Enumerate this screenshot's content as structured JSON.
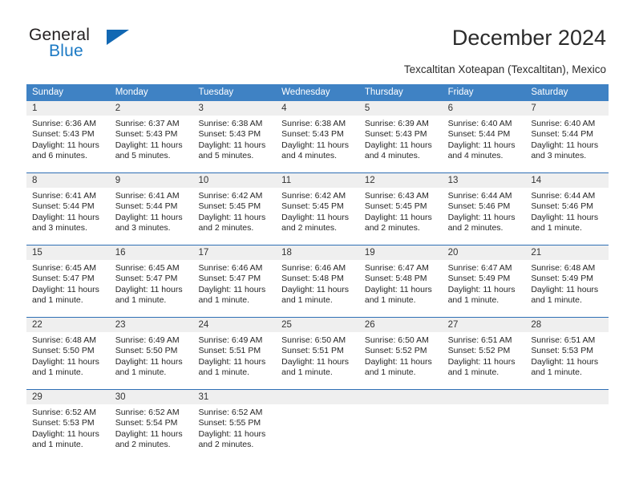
{
  "brand": {
    "word1": "General",
    "word2": "Blue",
    "triangle_icon": "brand-triangle-icon",
    "accent_color": "#1268b3"
  },
  "header": {
    "title": "December 2024",
    "subtitle": "Texcaltitan Xoteapan (Texcaltitan), Mexico"
  },
  "colors": {
    "header_blue": "#3f82c4",
    "row_divider_blue": "#2f6fb5",
    "day_band_gray": "#efefef",
    "text": "#262626"
  },
  "calendar": {
    "weekdays": [
      "Sunday",
      "Monday",
      "Tuesday",
      "Wednesday",
      "Thursday",
      "Friday",
      "Saturday"
    ],
    "weeks": [
      [
        {
          "day": "1",
          "sunrise": "Sunrise: 6:36 AM",
          "sunset": "Sunset: 5:43 PM",
          "daylight": "Daylight: 11 hours and 6 minutes."
        },
        {
          "day": "2",
          "sunrise": "Sunrise: 6:37 AM",
          "sunset": "Sunset: 5:43 PM",
          "daylight": "Daylight: 11 hours and 5 minutes."
        },
        {
          "day": "3",
          "sunrise": "Sunrise: 6:38 AM",
          "sunset": "Sunset: 5:43 PM",
          "daylight": "Daylight: 11 hours and 5 minutes."
        },
        {
          "day": "4",
          "sunrise": "Sunrise: 6:38 AM",
          "sunset": "Sunset: 5:43 PM",
          "daylight": "Daylight: 11 hours and 4 minutes."
        },
        {
          "day": "5",
          "sunrise": "Sunrise: 6:39 AM",
          "sunset": "Sunset: 5:43 PM",
          "daylight": "Daylight: 11 hours and 4 minutes."
        },
        {
          "day": "6",
          "sunrise": "Sunrise: 6:40 AM",
          "sunset": "Sunset: 5:44 PM",
          "daylight": "Daylight: 11 hours and 4 minutes."
        },
        {
          "day": "7",
          "sunrise": "Sunrise: 6:40 AM",
          "sunset": "Sunset: 5:44 PM",
          "daylight": "Daylight: 11 hours and 3 minutes."
        }
      ],
      [
        {
          "day": "8",
          "sunrise": "Sunrise: 6:41 AM",
          "sunset": "Sunset: 5:44 PM",
          "daylight": "Daylight: 11 hours and 3 minutes."
        },
        {
          "day": "9",
          "sunrise": "Sunrise: 6:41 AM",
          "sunset": "Sunset: 5:44 PM",
          "daylight": "Daylight: 11 hours and 3 minutes."
        },
        {
          "day": "10",
          "sunrise": "Sunrise: 6:42 AM",
          "sunset": "Sunset: 5:45 PM",
          "daylight": "Daylight: 11 hours and 2 minutes."
        },
        {
          "day": "11",
          "sunrise": "Sunrise: 6:42 AM",
          "sunset": "Sunset: 5:45 PM",
          "daylight": "Daylight: 11 hours and 2 minutes."
        },
        {
          "day": "12",
          "sunrise": "Sunrise: 6:43 AM",
          "sunset": "Sunset: 5:45 PM",
          "daylight": "Daylight: 11 hours and 2 minutes."
        },
        {
          "day": "13",
          "sunrise": "Sunrise: 6:44 AM",
          "sunset": "Sunset: 5:46 PM",
          "daylight": "Daylight: 11 hours and 2 minutes."
        },
        {
          "day": "14",
          "sunrise": "Sunrise: 6:44 AM",
          "sunset": "Sunset: 5:46 PM",
          "daylight": "Daylight: 11 hours and 1 minute."
        }
      ],
      [
        {
          "day": "15",
          "sunrise": "Sunrise: 6:45 AM",
          "sunset": "Sunset: 5:47 PM",
          "daylight": "Daylight: 11 hours and 1 minute."
        },
        {
          "day": "16",
          "sunrise": "Sunrise: 6:45 AM",
          "sunset": "Sunset: 5:47 PM",
          "daylight": "Daylight: 11 hours and 1 minute."
        },
        {
          "day": "17",
          "sunrise": "Sunrise: 6:46 AM",
          "sunset": "Sunset: 5:47 PM",
          "daylight": "Daylight: 11 hours and 1 minute."
        },
        {
          "day": "18",
          "sunrise": "Sunrise: 6:46 AM",
          "sunset": "Sunset: 5:48 PM",
          "daylight": "Daylight: 11 hours and 1 minute."
        },
        {
          "day": "19",
          "sunrise": "Sunrise: 6:47 AM",
          "sunset": "Sunset: 5:48 PM",
          "daylight": "Daylight: 11 hours and 1 minute."
        },
        {
          "day": "20",
          "sunrise": "Sunrise: 6:47 AM",
          "sunset": "Sunset: 5:49 PM",
          "daylight": "Daylight: 11 hours and 1 minute."
        },
        {
          "day": "21",
          "sunrise": "Sunrise: 6:48 AM",
          "sunset": "Sunset: 5:49 PM",
          "daylight": "Daylight: 11 hours and 1 minute."
        }
      ],
      [
        {
          "day": "22",
          "sunrise": "Sunrise: 6:48 AM",
          "sunset": "Sunset: 5:50 PM",
          "daylight": "Daylight: 11 hours and 1 minute."
        },
        {
          "day": "23",
          "sunrise": "Sunrise: 6:49 AM",
          "sunset": "Sunset: 5:50 PM",
          "daylight": "Daylight: 11 hours and 1 minute."
        },
        {
          "day": "24",
          "sunrise": "Sunrise: 6:49 AM",
          "sunset": "Sunset: 5:51 PM",
          "daylight": "Daylight: 11 hours and 1 minute."
        },
        {
          "day": "25",
          "sunrise": "Sunrise: 6:50 AM",
          "sunset": "Sunset: 5:51 PM",
          "daylight": "Daylight: 11 hours and 1 minute."
        },
        {
          "day": "26",
          "sunrise": "Sunrise: 6:50 AM",
          "sunset": "Sunset: 5:52 PM",
          "daylight": "Daylight: 11 hours and 1 minute."
        },
        {
          "day": "27",
          "sunrise": "Sunrise: 6:51 AM",
          "sunset": "Sunset: 5:52 PM",
          "daylight": "Daylight: 11 hours and 1 minute."
        },
        {
          "day": "28",
          "sunrise": "Sunrise: 6:51 AM",
          "sunset": "Sunset: 5:53 PM",
          "daylight": "Daylight: 11 hours and 1 minute."
        }
      ],
      [
        {
          "day": "29",
          "sunrise": "Sunrise: 6:52 AM",
          "sunset": "Sunset: 5:53 PM",
          "daylight": "Daylight: 11 hours and 1 minute."
        },
        {
          "day": "30",
          "sunrise": "Sunrise: 6:52 AM",
          "sunset": "Sunset: 5:54 PM",
          "daylight": "Daylight: 11 hours and 2 minutes."
        },
        {
          "day": "31",
          "sunrise": "Sunrise: 6:52 AM",
          "sunset": "Sunset: 5:55 PM",
          "daylight": "Daylight: 11 hours and 2 minutes."
        },
        {
          "day": "",
          "sunrise": "",
          "sunset": "",
          "daylight": ""
        },
        {
          "day": "",
          "sunrise": "",
          "sunset": "",
          "daylight": ""
        },
        {
          "day": "",
          "sunrise": "",
          "sunset": "",
          "daylight": ""
        },
        {
          "day": "",
          "sunrise": "",
          "sunset": "",
          "daylight": ""
        }
      ]
    ]
  }
}
